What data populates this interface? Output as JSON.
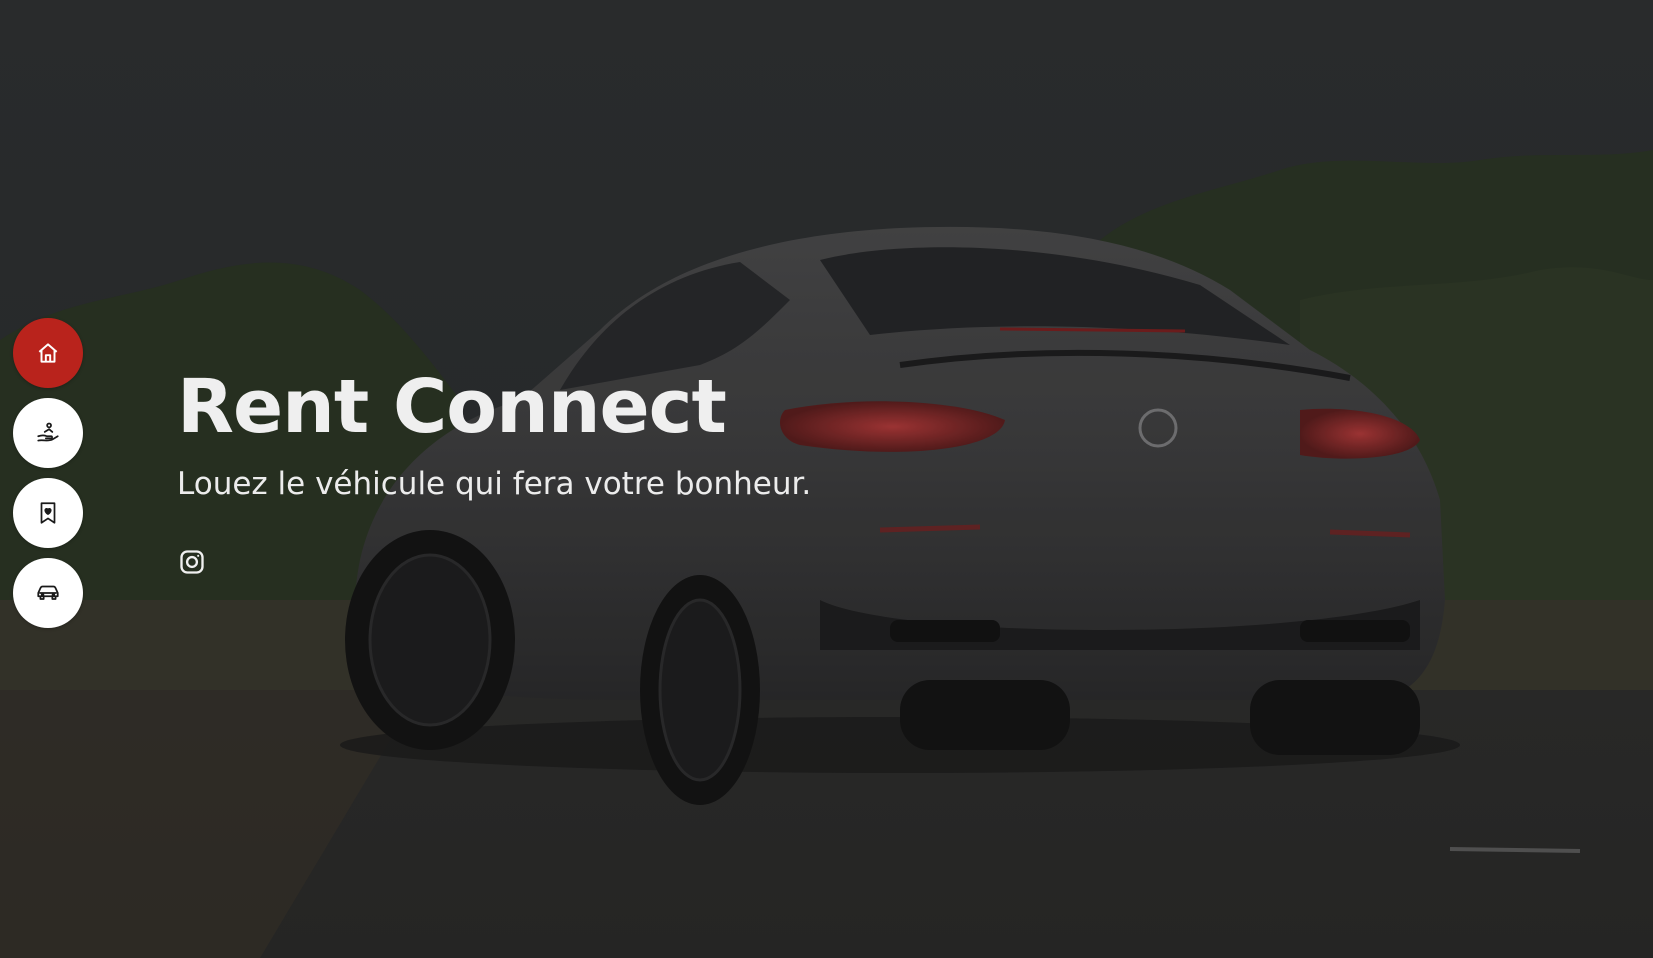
{
  "hero": {
    "title": "Rent Connect",
    "subtitle": "Louez le véhicule qui fera votre bonheur."
  },
  "sidenav": {
    "items": [
      {
        "icon": "home-icon",
        "active": true
      },
      {
        "icon": "hand-person-icon",
        "active": false
      },
      {
        "icon": "bookmark-heart-icon",
        "active": false
      },
      {
        "icon": "car-icon",
        "active": false
      }
    ]
  },
  "social": {
    "icon": "instagram-icon"
  },
  "colors": {
    "accent": "#b9231c",
    "nav_bg": "#ffffff",
    "text": "#efefef"
  }
}
